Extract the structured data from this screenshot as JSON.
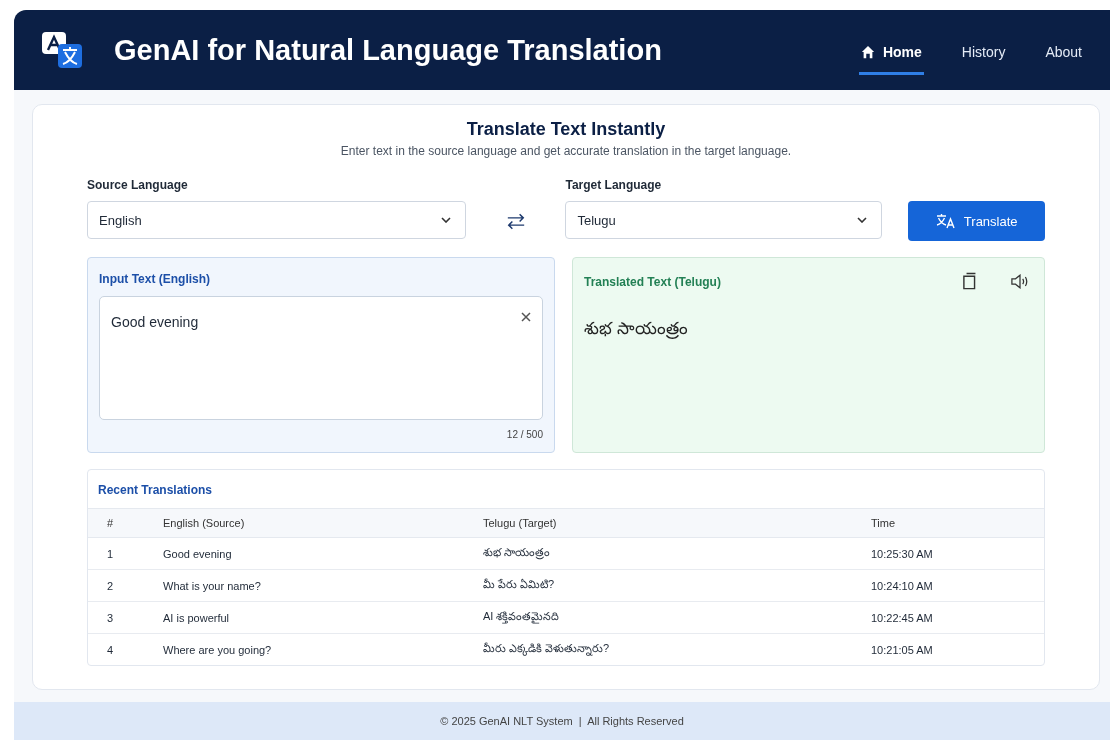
{
  "header": {
    "title": "GenAI for Natural Language Translation",
    "nav": [
      {
        "label": "Home",
        "selected": true
      },
      {
        "label": "History",
        "selected": false
      },
      {
        "label": "About",
        "selected": false
      }
    ]
  },
  "hero": {
    "title": "Translate Text Instantly",
    "subtitle": "Enter text in the source language and get accurate translation in the target language."
  },
  "source": {
    "label": "Source Language",
    "value": "English"
  },
  "target": {
    "label": "Target Language",
    "value": "Telugu"
  },
  "translate_button": "Translate",
  "input_panel": {
    "title": "Input Text (English)",
    "value": "Good evening",
    "counter": "12 / 500"
  },
  "output_panel": {
    "title": "Translated Text (Telugu)",
    "value": "శుభ సాయంత్రం"
  },
  "recent": {
    "title": "Recent Translations",
    "columns": [
      "#",
      "English (Source)",
      "Telugu (Target)",
      "Time"
    ],
    "rows": [
      [
        "1",
        "Good evening",
        "శుభ సాయంత్రం",
        "10:25:30 AM"
      ],
      [
        "2",
        "What is your name?",
        "మీ పేరు ఏమిటి?",
        "10:24:10 AM"
      ],
      [
        "3",
        "AI is powerful",
        "AI శక్తివంతమైనది",
        "10:22:45 AM"
      ],
      [
        "4",
        "Where are you going?",
        "మీరు ఎక్కడికి వెళుతున్నారు?",
        "10:21:05 AM"
      ]
    ]
  },
  "footer": "© 2025 GenAI NLT System  |  All Rights Reserved"
}
